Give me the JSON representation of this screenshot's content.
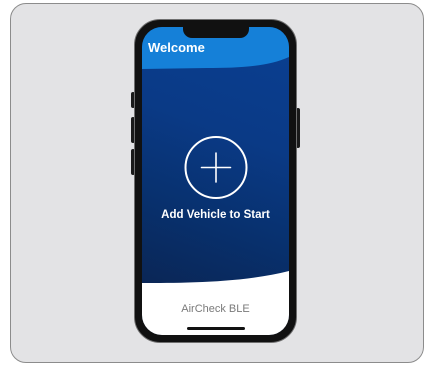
{
  "header": {
    "title": "Welcome"
  },
  "main": {
    "add_vehicle_label": "Add Vehicle to Start",
    "add_icon": "plus-circle-icon"
  },
  "footer": {
    "app_name": "AirCheck BLE"
  },
  "colors": {
    "header_blue": "#1580d8",
    "screen_blue": "#0a3f92",
    "screen_dark": "#0b2048",
    "footer_white": "#ffffff",
    "card_bg": "#e3e3e5"
  }
}
